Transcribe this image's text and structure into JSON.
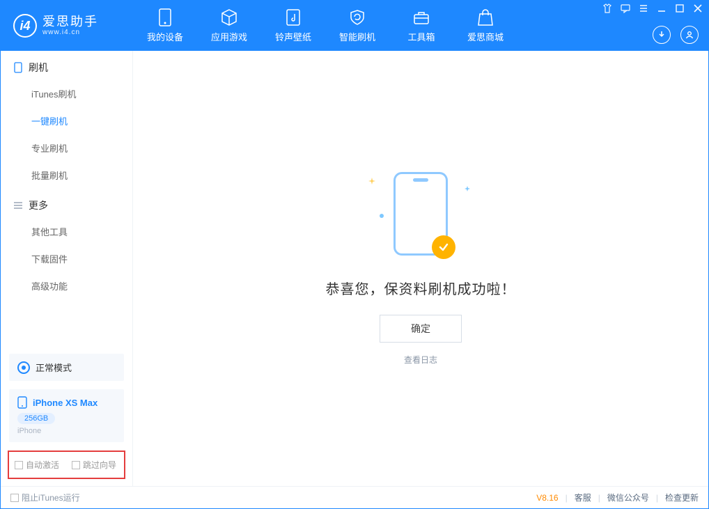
{
  "brand": {
    "name": "爱思助手",
    "url": "www.i4.cn"
  },
  "navTabs": [
    {
      "label": "我的设备"
    },
    {
      "label": "应用游戏"
    },
    {
      "label": "铃声壁纸"
    },
    {
      "label": "智能刷机"
    },
    {
      "label": "工具箱"
    },
    {
      "label": "爱思商城"
    }
  ],
  "sidebar": {
    "sections": [
      {
        "title": "刷机",
        "items": [
          "iTunes刷机",
          "一键刷机",
          "专业刷机",
          "批量刷机"
        ],
        "activeIndex": 1
      },
      {
        "title": "更多",
        "items": [
          "其他工具",
          "下载固件",
          "高级功能"
        ],
        "activeIndex": -1
      }
    ],
    "modeLabel": "正常模式",
    "device": {
      "name": "iPhone XS Max",
      "storage": "256GB",
      "type": "iPhone"
    },
    "bottomChecks": [
      "自动激活",
      "跳过向导"
    ]
  },
  "main": {
    "successTitle": "恭喜您，保资料刷机成功啦！",
    "okLabel": "确定",
    "viewLogLabel": "查看日志"
  },
  "statusbar": {
    "blockItunes": "阻止iTunes运行",
    "version": "V8.16",
    "links": [
      "客服",
      "微信公众号",
      "检查更新"
    ]
  }
}
